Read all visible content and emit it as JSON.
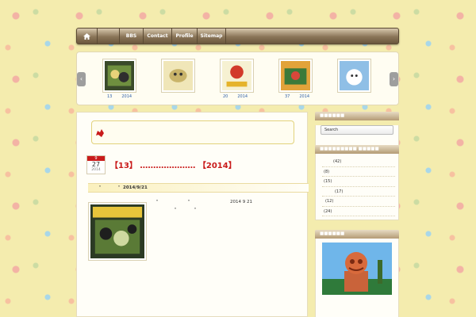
{
  "nav": {
    "items": [
      {
        "label": "BBS"
      },
      {
        "label": "Contact"
      },
      {
        "label": "Profile"
      },
      {
        "label": "Sitemap"
      }
    ]
  },
  "slider": {
    "captions": [
      {
        "num": "13",
        "year": "2014"
      },
      {
        "num": "20",
        "year": "2014"
      },
      {
        "num": "37",
        "year": "2014"
      }
    ]
  },
  "post": {
    "month": "9",
    "day": "27",
    "year": "2014",
    "title": "【13】 ………………… 【2014】",
    "meta_prefix": "\"",
    "meta_suffix": "\"",
    "meta_date": "2014/9/21",
    "text_line1_a": "\"",
    "text_line1_b": "\"",
    "text_line1_date": "2014 9 21",
    "text_line2_a": "\"",
    "text_line2_b": "\""
  },
  "sidebar": {
    "search_placeholder": "Search",
    "counts": [
      "(42)",
      "(8)",
      "(15)",
      "(17)",
      "(12)",
      "(24)"
    ]
  },
  "colors": {
    "accent": "#c91b1b",
    "link": "#2c5ea8",
    "nav_bar": "#8a7558"
  }
}
